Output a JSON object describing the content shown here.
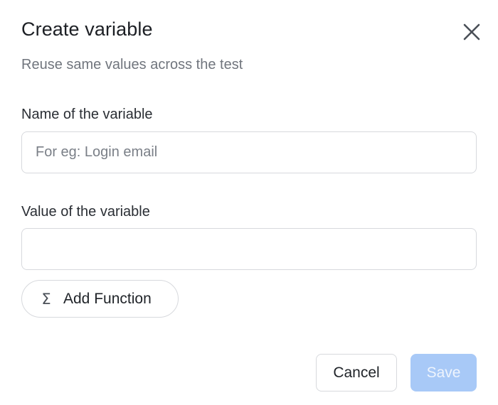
{
  "dialog": {
    "title": "Create variable",
    "subtitle": "Reuse same values across the test",
    "close_icon": "close-icon"
  },
  "name_field": {
    "label": "Name of the variable",
    "value": "",
    "placeholder": "For eg: Login email"
  },
  "value_field": {
    "label": "Value of the variable",
    "value": "",
    "placeholder": ""
  },
  "add_function": {
    "icon": "sigma-icon",
    "icon_glyph": "Σ",
    "label": "Add Function"
  },
  "footer": {
    "cancel_label": "Cancel",
    "save_label": "Save",
    "save_disabled": true
  },
  "colors": {
    "save_button_bg": "#a8c9f7",
    "border": "#d7d9dd",
    "subtitle_text": "#70757d"
  }
}
